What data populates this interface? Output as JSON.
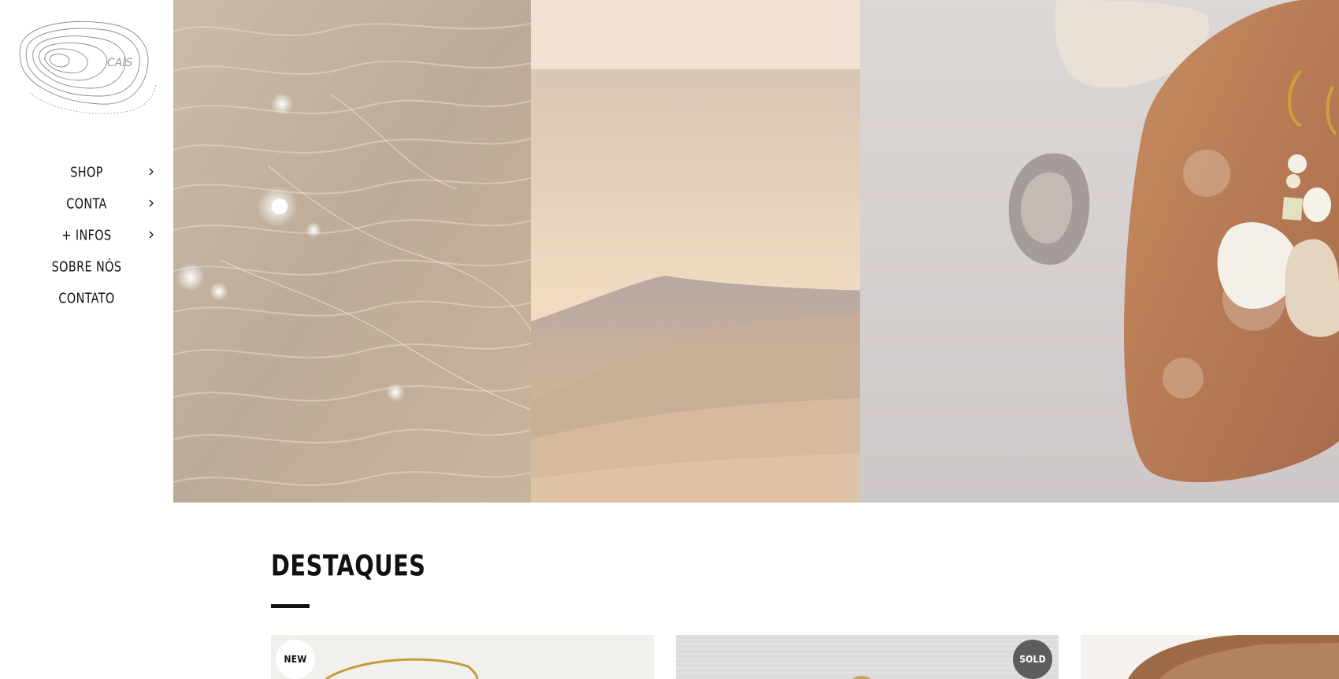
{
  "brand": {
    "logo_text": "CAIS"
  },
  "nav": {
    "items": [
      {
        "label": "SHOP",
        "has_submenu": true
      },
      {
        "label": "CONTA",
        "has_submenu": true
      },
      {
        "label": "+ INFOS",
        "has_submenu": true
      },
      {
        "label": "SOBRE NÓS",
        "has_submenu": false
      },
      {
        "label": "CONTATO",
        "has_submenu": false
      }
    ]
  },
  "hero": {
    "panels": [
      "water-ripples-image",
      "dune-image",
      "earrings-on-stone-image"
    ]
  },
  "featured": {
    "title": "DESTAQUES",
    "products": [
      {
        "badge": "NEW"
      },
      {
        "badge": "SOLD"
      },
      {
        "badge": ""
      }
    ]
  },
  "colors": {
    "text": "#111111",
    "peach": "#f2e2d3",
    "sold_badge": "#5d5d5d"
  }
}
